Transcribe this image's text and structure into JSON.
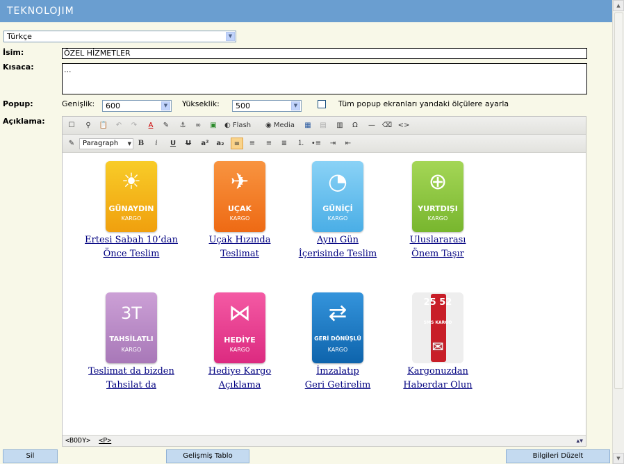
{
  "header": {
    "logo": "TEKNOLOJIM"
  },
  "language": {
    "selected": "Türkçe"
  },
  "form": {
    "name_label": "İsim:",
    "name_value": "ÖZEL HİZMETLER",
    "short_label": "Kısaca:",
    "short_value": "...",
    "popup_label": "Popup:",
    "width_label": "Genişlik:",
    "width_value": "600",
    "height_label": "Yükseklik:",
    "height_value": "500",
    "popup_checkbox_label": "Tüm popup ekranları yandaki ölçülere ayarla",
    "description_label": "Açıklama:"
  },
  "editor": {
    "toolbar1": {
      "flash_label": "Flash",
      "media_label": "Media"
    },
    "toolbar2": {
      "format_value": "Paragraph"
    },
    "statusbar": {
      "body_tag": "<BODY>",
      "p_tag": "<P>"
    },
    "items": [
      {
        "name": "GÜNAYDIN",
        "sub": "KARGO",
        "color": "#f2b416",
        "line1": "Ertesi Sabah 10’dan",
        "line2": "Önce Teslim"
      },
      {
        "name": "UÇAK",
        "sub": "KARGO",
        "color": "#f27a1e",
        "line1": "Uçak Hızında",
        "line2": "Teslimat"
      },
      {
        "name": "GÜNİÇİ",
        "sub": "KARGO",
        "color": "#6cc0ec",
        "line1": "Aynı Gün",
        "line2": "İçerisinde Teslim"
      },
      {
        "name": "YURTDIŞI",
        "sub": "KARGO",
        "color": "#8cc63e",
        "line1": "Uluslararası",
        "line2": "Önem Taşır"
      },
      {
        "name": "TAHSİLATLI",
        "sub": "KARGO",
        "color": "#b888c4",
        "line1": "Teslimat da bizden",
        "line2": "Tahsilat da"
      },
      {
        "name": "HEDİYE",
        "sub": "KARGO",
        "color": "#e8388c",
        "line1": "Hediye Kargo",
        "line2": "Açıklama"
      },
      {
        "name": "GERİ DÖNÜŞLÜ",
        "sub": "KARGO",
        "color": "#1a7cc4",
        "line1": "İmzalatıp",
        "line2": "Geri Getirelim"
      },
      {
        "name": "25 52",
        "sub": "SMS KARGO",
        "color": "#c81e28",
        "line1": "Kargonuzdan",
        "line2": "Haberdar Olun"
      }
    ]
  },
  "buttons": {
    "delete": "Sil",
    "advanced_table": "Gelişmiş Tablo",
    "save": "Bilgileri Düzelt"
  }
}
